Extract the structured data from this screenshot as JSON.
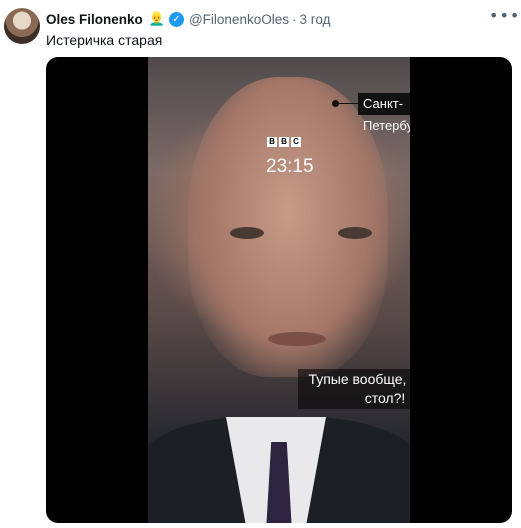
{
  "tweet": {
    "author_name": "Oles Filonenko",
    "author_emoji": "👱‍♂️",
    "handle": "@FilonenkoOles",
    "separator": "·",
    "time": "3 год",
    "more_icon": "more-horizontal-icon",
    "more_glyph": "•••",
    "verified_glyph": "✓",
    "text": "Истеричка старая"
  },
  "video": {
    "location_tag": "Санкт-Петербург",
    "bbc_letters": [
      "B",
      "B",
      "C"
    ],
    "clock": "23:15",
    "subtitle": "Тупые вообще, как этот стол?!"
  },
  "colors": {
    "verified_blue": "#1d9bf0",
    "secondary_text": "#536471",
    "media_bg": "#000000"
  }
}
